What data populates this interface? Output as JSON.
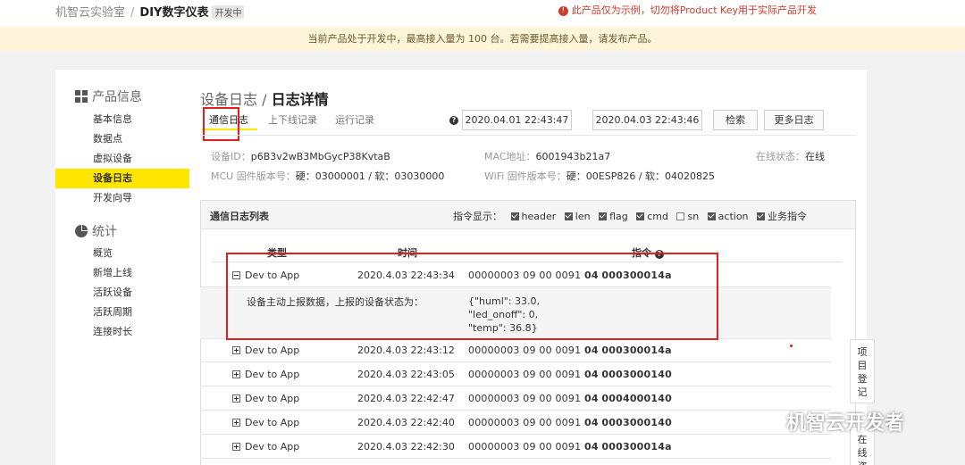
{
  "breadcrumb": {
    "lab": "机智云实验室",
    "sep": "/",
    "product": "DIY数字仪表",
    "badge": "开发中"
  },
  "warning": {
    "icon": "exclamation-icon",
    "text": "此产品仅为示例，切勿将Product Key用于实际产品开发"
  },
  "banner": {
    "text": "当前产品处于开发中，最高接入量为 100 台。若需要提高接入量，请发布产品。"
  },
  "sidebar": {
    "sections": [
      {
        "title": "产品信息",
        "icon": "grid-icon",
        "items": [
          "基本信息",
          "数据点",
          "虚拟设备",
          "设备日志",
          "开发向导"
        ]
      },
      {
        "title": "统计",
        "icon": "pie-chart-icon",
        "items": [
          "概览",
          "新增上线",
          "活跃设备",
          "活跃周期",
          "连接时长"
        ]
      }
    ],
    "active": "设备日志"
  },
  "page": {
    "title_parent": "设备日志",
    "title_sep": "/",
    "title_current": "日志详情"
  },
  "tabs": [
    "通信日志",
    "上下线记录",
    "运行记录"
  ],
  "toolbar": {
    "start": "2020.04.01 22:43:47",
    "end": "2020.04.03 22:43:46",
    "search": "检索",
    "more": "更多日志"
  },
  "device": {
    "id_label": "设备ID：",
    "id": "p6B3v2wB3MbGycP38KvtaB",
    "mac_label": "MAC地址：",
    "mac": "6001943b21a7",
    "status_label": "在线状态：",
    "status": "在线",
    "mcu_label": "MCU 固件版本号：",
    "mcu": "硬：03000001 / 软：03030000",
    "wifi_label": "WiFi 固件版本号：",
    "wifi": "硬：00ESP826 / 软：04020825"
  },
  "panel": {
    "title": "通信日志列表",
    "filter_label": "指令显示：",
    "filters": [
      {
        "label": "header",
        "checked": true
      },
      {
        "label": "len",
        "checked": true
      },
      {
        "label": "flag",
        "checked": true
      },
      {
        "label": "cmd",
        "checked": true
      },
      {
        "label": "sn",
        "checked": false
      },
      {
        "label": "action",
        "checked": true
      },
      {
        "label": "业务指令",
        "checked": true
      }
    ],
    "columns": [
      "类型",
      "时间",
      "指令"
    ]
  },
  "rows": [
    {
      "type": "Dev to App",
      "time": "2020.4.03 22:43:34",
      "cmd_prefix": "00000003  09  00  0091",
      "cmd_action": "04",
      "cmd_payload": "000300014a",
      "expanded": true
    },
    {
      "type": "Dev to App",
      "time": "2020.4.03 22:43:12",
      "cmd_prefix": "00000003  09  00  0091",
      "cmd_action": "04",
      "cmd_payload": "000300014a",
      "expanded": false
    },
    {
      "type": "Dev to App",
      "time": "2020.4.03 22:43:05",
      "cmd_prefix": "00000003  09  00  0091",
      "cmd_action": "04",
      "cmd_payload": "0003000140",
      "expanded": false
    },
    {
      "type": "Dev to App",
      "time": "2020.4.03 22:42:47",
      "cmd_prefix": "00000003  09  00  0091",
      "cmd_action": "04",
      "cmd_payload": "0004000140",
      "expanded": false
    },
    {
      "type": "Dev to App",
      "time": "2020.4.03 22:42:40",
      "cmd_prefix": "00000003  09  00  0091",
      "cmd_action": "04",
      "cmd_payload": "0003000140",
      "expanded": false
    },
    {
      "type": "Dev to App",
      "time": "2020.4.03 22:42:30",
      "cmd_prefix": "00000003  09  00  0091",
      "cmd_action": "04",
      "cmd_payload": "000300014a",
      "expanded": false
    }
  ],
  "detail": {
    "label": "设备主动上报数据，上报的设备状态为：",
    "json_lines": [
      "{\"huml\": 33.0,",
      "\"led_onoff\": 0,",
      "\"temp\": 36.8}"
    ]
  },
  "float": {
    "register": "项目登记",
    "consult": "在线咨"
  },
  "watermark": {
    "icon": "wechat-icon",
    "text": "机智云开发者"
  },
  "colors": {
    "accent": "#ffe600",
    "highlight": "#e02020",
    "banner_bg": "#fdf4d9"
  }
}
